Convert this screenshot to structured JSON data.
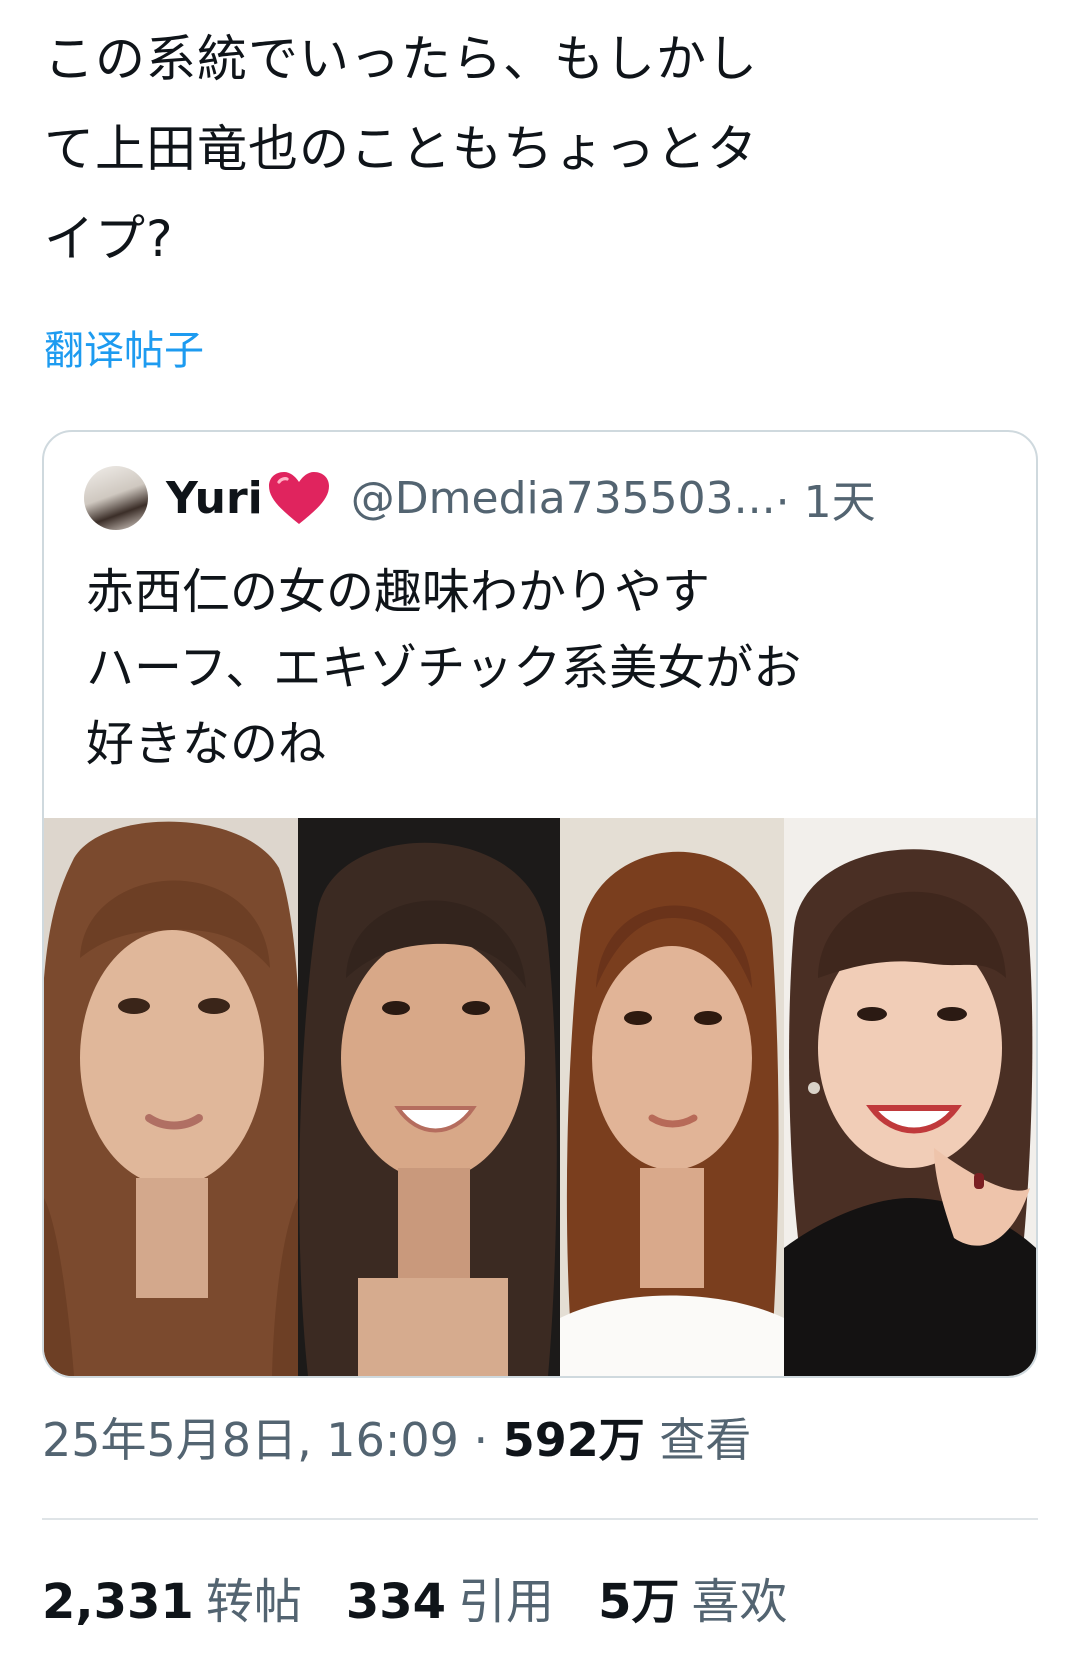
{
  "tweet": {
    "text": "この系統でいったら、もしかし\nて上田竜也のこともちょっとタ\nイプ?",
    "translate_label": "翻译帖子"
  },
  "quote": {
    "name": "Yuri",
    "heart": "❤️",
    "handle": "@Dmedia735503...",
    "time": " · 1天",
    "text": "赤西仁の女の趣味わかりやす\nハーフ、エキゾチック系美女がお\n好きなのね",
    "colors": {
      "heart": "#e0245e"
    }
  },
  "meta": {
    "date": "25年5月8日, 16:09 · ",
    "views": "592万",
    "views_label": " 查看"
  },
  "stats": {
    "retweets": "2,331",
    "retweets_label": "转帖",
    "quotes": "334",
    "quotes_label": "引用",
    "likes": "5万",
    "likes_label": "喜欢"
  },
  "colors": {
    "link": "#1d9bf0",
    "muted": "#536471",
    "text": "#0f1419"
  }
}
